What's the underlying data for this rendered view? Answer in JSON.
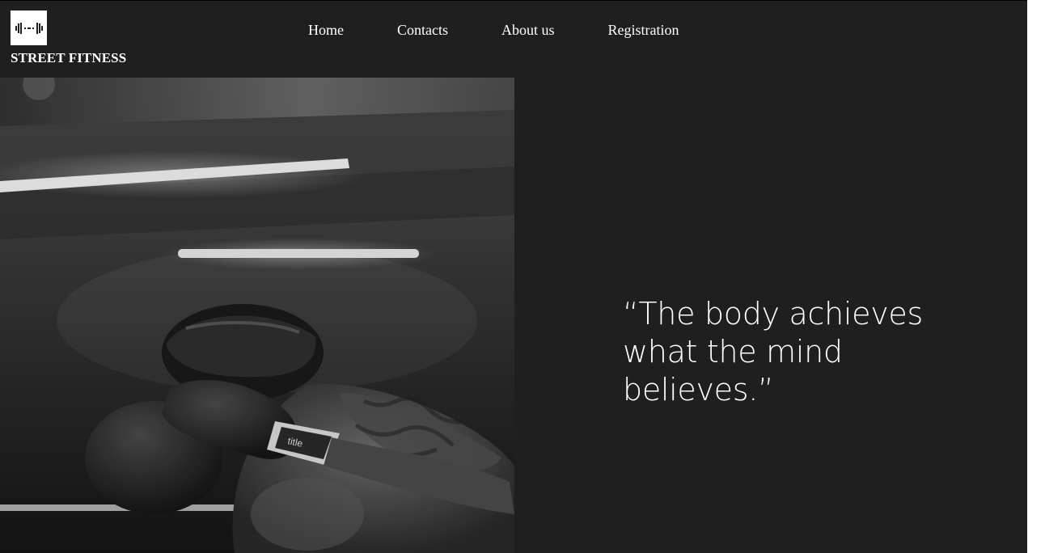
{
  "header": {
    "logo_icon": "dumbbell-icon",
    "brand": "STREET FITNESS",
    "nav": [
      {
        "label": "Home"
      },
      {
        "label": "Contacts"
      },
      {
        "label": "About us"
      },
      {
        "label": "Registration"
      }
    ]
  },
  "hero": {
    "image_subject": "boxer-photo"
  },
  "quote": {
    "text": "“The body achieves what the mind believes.”"
  },
  "colors": {
    "background": "#1f1f1f",
    "text": "#ffffff",
    "logo_bg": "#ffffff"
  }
}
